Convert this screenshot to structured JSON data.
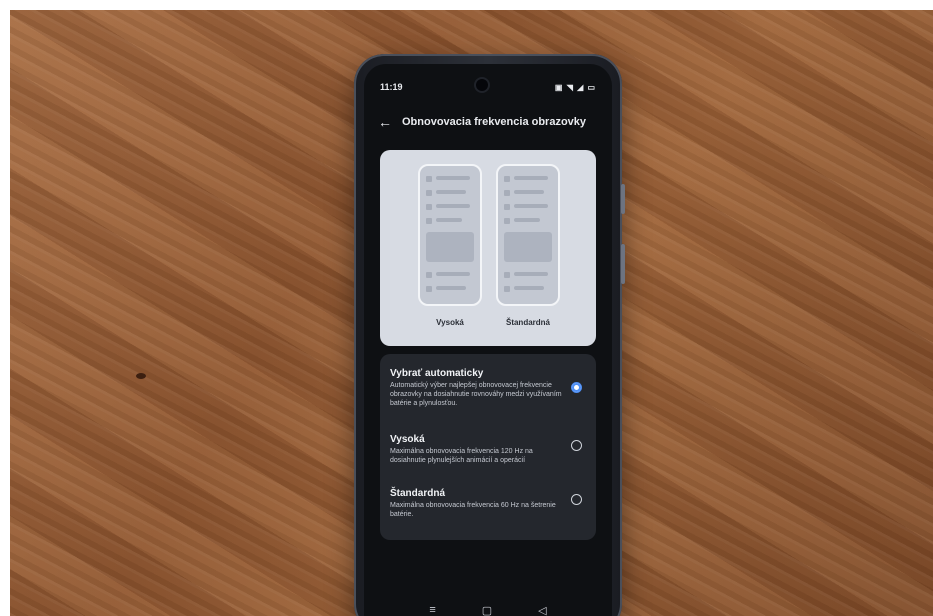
{
  "status_bar": {
    "time": "11:19",
    "icons": "▣ ◥ ◢ ▭"
  },
  "app_bar": {
    "back_icon": "←",
    "title": "Obnovovacia frekvencia obrazovky"
  },
  "preview": {
    "label_left": "Vysoká",
    "label_right": "Štandardná"
  },
  "options": [
    {
      "title": "Vybrať automaticky",
      "description": "Automatický výber najlepšej obnovovacej frekvencie obrazovky na dosiahnutie rovnováhy medzi využívaním batérie a plynulosťou.",
      "selected": true
    },
    {
      "title": "Vysoká",
      "description": "Maximálna obnovovacia frekvencia 120 Hz na dosiahnutie plynulejších animácií a operácií",
      "selected": false
    },
    {
      "title": "Štandardná",
      "description": "Maximálna obnovovacia frekvencia 60 Hz na šetrenie batérie.",
      "selected": false
    }
  ],
  "nav_bar": {
    "menu_icon": "≡",
    "home_icon": "▢",
    "back_icon": "◁"
  },
  "colors": {
    "accent": "#4e8ff5",
    "panel": "#24272d",
    "wood": "#9c6238"
  }
}
